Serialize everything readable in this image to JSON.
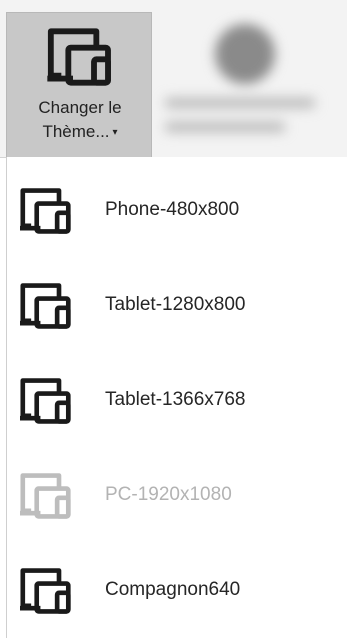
{
  "ribbon": {
    "theme_button": {
      "label_line1": "Changer le",
      "label_line2": "Thème...",
      "caret": "▾",
      "icon": "device-layout-icon"
    }
  },
  "menu": {
    "items": [
      {
        "label": "Phone-480x800",
        "icon": "device-layout-icon",
        "disabled": false
      },
      {
        "label": "Tablet-1280x800",
        "icon": "device-layout-icon",
        "disabled": false
      },
      {
        "label": "Tablet-1366x768",
        "icon": "device-layout-icon",
        "disabled": false
      },
      {
        "label": "PC-1920x1080",
        "icon": "device-layout-icon",
        "disabled": true
      },
      {
        "label": "Compagnon640",
        "icon": "device-layout-icon",
        "disabled": false
      }
    ]
  },
  "colors": {
    "icon_enabled": "#1a1a1a",
    "icon_disabled": "#bdbdbd",
    "selected_button_bg": "#c8c8c8"
  }
}
